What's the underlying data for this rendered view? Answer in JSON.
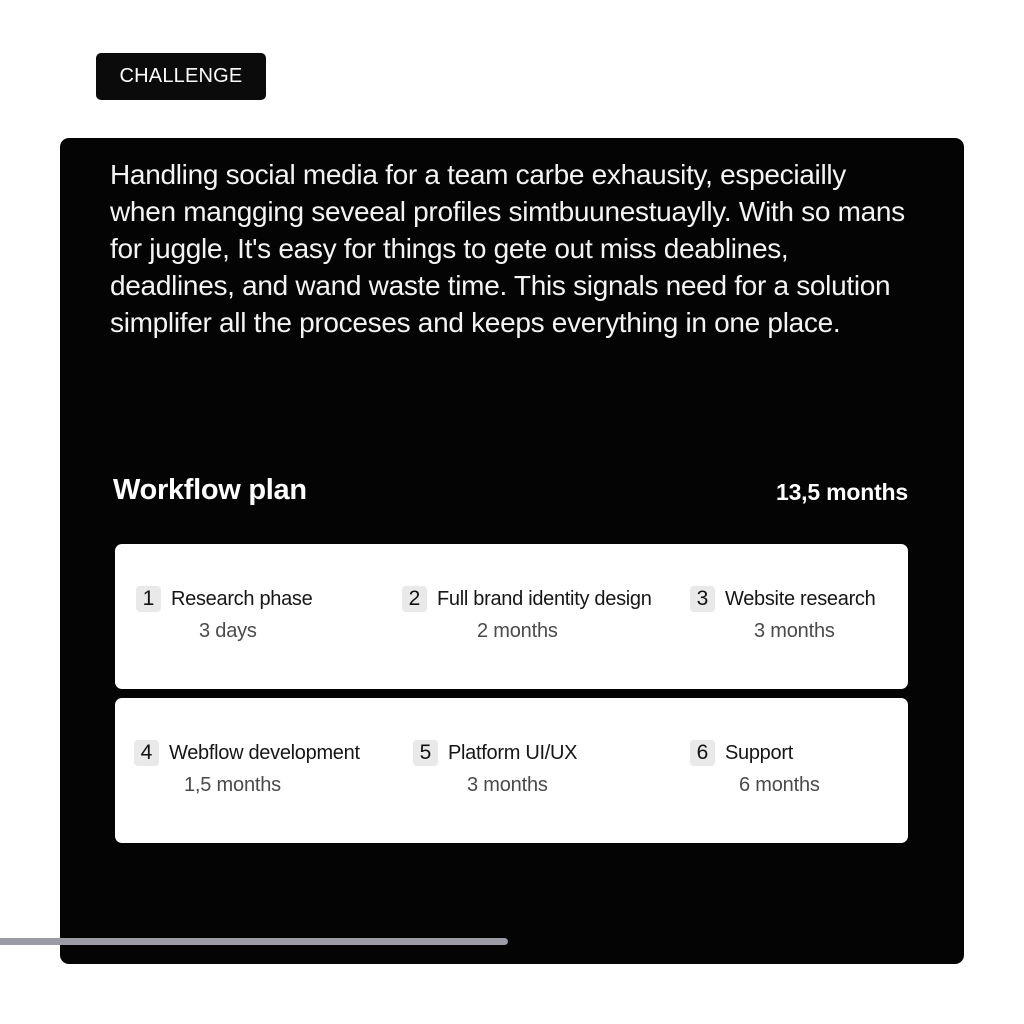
{
  "tag": {
    "label": "CHALLENGE"
  },
  "challenge": {
    "text": "Handling social media for a team carbe exhausity, especiailly when mangging seveeal profiles simtbuunestuaylly. With so mans for juggle, It's easy for things to gete out miss deablines, deadlines, and wand waste time. This signals need for a solution simplifer all the proceses and keeps everything in one place."
  },
  "workflow": {
    "title": "Workflow plan",
    "total": "13,5 months",
    "rows": [
      [
        {
          "num": "1",
          "name": "Research phase",
          "duration": "3 days"
        },
        {
          "num": "2",
          "name": "Full brand identity design",
          "duration": "2 months"
        },
        {
          "num": "3",
          "name": "Website research",
          "duration": "3 months"
        }
      ],
      [
        {
          "num": "4",
          "name": "Webflow development",
          "duration": "1,5 months"
        },
        {
          "num": "5",
          "name": "Platform UI/UX",
          "duration": "3 months"
        },
        {
          "num": "6",
          "name": "Support",
          "duration": "6 months"
        }
      ]
    ]
  },
  "progress": {
    "fraction": 0.5
  },
  "colors": {
    "panel": "#040404",
    "card": "#ffffff",
    "badge": "#e9e9e9",
    "progress": "#9b9ba5"
  }
}
